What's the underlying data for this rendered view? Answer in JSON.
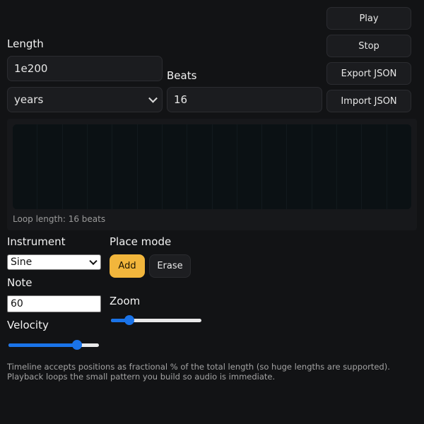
{
  "controls": {
    "play_label": "Play",
    "stop_label": "Stop",
    "export_label": "Export JSON",
    "import_label": "Import JSON"
  },
  "length": {
    "label": "Length",
    "value": "1e200",
    "unit": "years"
  },
  "beats": {
    "label": "Beats",
    "value": "16"
  },
  "timeline": {
    "loop_text": "Loop length: 16 beats"
  },
  "instrument": {
    "label": "Instrument",
    "value": "Sine"
  },
  "note": {
    "label": "Note",
    "value": "60"
  },
  "velocity": {
    "label": "Velocity",
    "level": 0.76
  },
  "place_mode": {
    "label": "Place mode",
    "add_label": "Add",
    "erase_label": "Erase",
    "selected": "Add"
  },
  "zoom": {
    "label": "Zoom",
    "level": 0.2
  },
  "footnote": "Timeline accepts positions as fractional % of the total length (so huge lengths are supported). Playback loops the small pattern you build so audio is immediate.",
  "colors": {
    "background": "#121315",
    "accent": "#f2b63c",
    "slider": "#1a73e8"
  }
}
